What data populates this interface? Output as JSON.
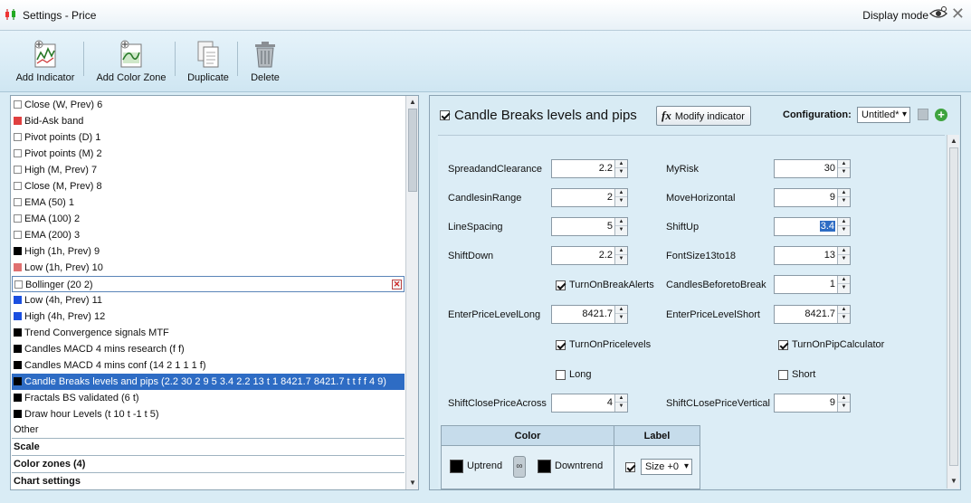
{
  "window": {
    "title": "Settings - Price",
    "display_mode_label": "Display mode"
  },
  "toolbar": {
    "add_indicator": "Add Indicator",
    "add_color_zone": "Add Color Zone",
    "duplicate": "Duplicate",
    "delete": "Delete"
  },
  "list": {
    "items": [
      {
        "label": "Close (W, Prev) 6",
        "swatch": "#ffffff"
      },
      {
        "label": "Bid-Ask band",
        "swatch": "#e04040"
      },
      {
        "label": "Pivot points (D) 1",
        "swatch": "#ffffff"
      },
      {
        "label": "Pivot points (M) 2",
        "swatch": "#ffffff"
      },
      {
        "label": "High (M, Prev) 7",
        "swatch": "#ffffff"
      },
      {
        "label": "Close (M, Prev) 8",
        "swatch": "#ffffff"
      },
      {
        "label": "EMA (50) 1",
        "swatch": "#ffffff"
      },
      {
        "label": "EMA (100) 2",
        "swatch": "#ffffff"
      },
      {
        "label": "EMA (200) 3",
        "swatch": "#ffffff"
      },
      {
        "label": "High (1h, Prev) 9",
        "swatch": "#000000"
      },
      {
        "label": "Low (1h, Prev) 10",
        "swatch": "#e07070"
      },
      {
        "label": "Bollinger (20 2)",
        "swatch": "#ffffff"
      },
      {
        "label": "Low (4h, Prev) 11",
        "swatch": "#1a4fe0"
      },
      {
        "label": "High (4h, Prev) 12",
        "swatch": "#1a4fe0"
      },
      {
        "label": "Trend Convergence signals MTF",
        "swatch": "#000000"
      },
      {
        "label": "Candles  MACD 4 mins research (f f)",
        "swatch": "#000000"
      },
      {
        "label": "Candles  MACD 4 mins conf (14 2 1 1 1 f)",
        "swatch": "#000000"
      },
      {
        "label": "Candle Breaks levels and pips (2.2 30 2 9 5 3.4 2.2 13 t 1 8421.7 8421.7 t t f f 4 9)",
        "swatch": "#000000"
      },
      {
        "label": "Fractals BS validated (6 t)",
        "swatch": "#000000"
      },
      {
        "label": "Draw hour Levels (t 10 t -1 t 5)",
        "swatch": "#000000"
      }
    ],
    "other_label": "Other",
    "sections": [
      "Scale",
      "Color zones (4)",
      "Chart settings"
    ]
  },
  "indicator": {
    "title": "Candle Breaks levels and pips",
    "modify_label": "Modify indicator",
    "config_label": "Configuration:",
    "config_value": "Untitled*"
  },
  "params": {
    "spread_label": "SpreadandClearance",
    "spread_value": "2.2",
    "myrisk_label": "MyRisk",
    "myrisk_value": "30",
    "candlesinrange_label": "CandlesinRange",
    "candlesinrange_value": "2",
    "movehorizontal_label": "MoveHorizontal",
    "movehorizontal_value": "9",
    "linespacing_label": "LineSpacing",
    "linespacing_value": "5",
    "shiftup_label": "ShiftUp",
    "shiftup_value": "3.4",
    "shiftdown_label": "ShiftDown",
    "shiftdown_value": "2.2",
    "fontsize_label": "FontSize13to18",
    "fontsize_value": "13",
    "turnonbreakalerts_label": "TurnOnBreakAlerts",
    "candlesbefore_label": "CandlesBeforetoBreak",
    "candlesbefore_value": "1",
    "enterlong_label": "EnterPriceLevelLong",
    "enterlong_value": "8421.7",
    "entershort_label": "EnterPriceLevelShort",
    "entershort_value": "8421.7",
    "turnonpricelevels_label": "TurnOnPricelevels",
    "turnonpipcalc_label": "TurnOnPipCalculator",
    "long_label": "Long",
    "short_label": "Short",
    "shiftclose_label": "ShiftClosePriceAcross",
    "shiftclose_value": "4",
    "shiftclosevert_label": "ShiftCLosePriceVertical",
    "shiftclosevert_value": "9"
  },
  "color_table": {
    "color_header": "Color",
    "label_header": "Label",
    "uptrend": "Uptrend",
    "downtrend": "Downtrend",
    "size_value": "Size +0"
  }
}
